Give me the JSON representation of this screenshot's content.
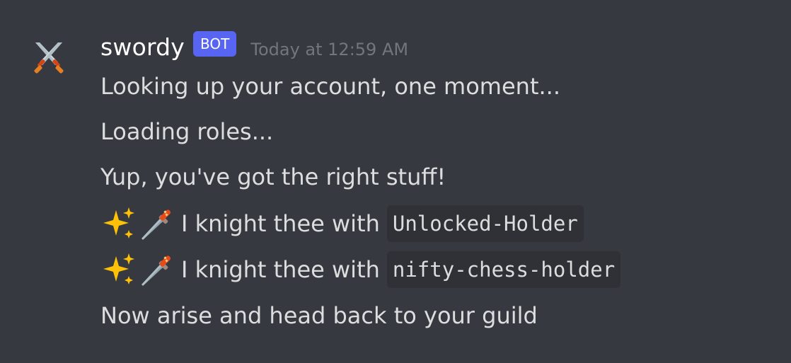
{
  "message": {
    "author": {
      "username": "swordy",
      "bot_tag": "BOT",
      "timestamp": "Today at 12:59 AM",
      "avatar_icon": "crossed-swords-icon"
    },
    "lines": {
      "line1": "Looking up your account, one moment...",
      "line2": "Loading roles...",
      "line3": "Yup, you've got the right stuff!",
      "line4_text": "I knight thee with",
      "line4_role": "Unlocked-Holder",
      "line5_text": "I knight thee with",
      "line5_role": "nifty-chess-holder",
      "line6": "Now arise and head back to your guild"
    },
    "emoji_icons": [
      "sparkles-icon",
      "dagger-icon"
    ],
    "colors": {
      "background": "#36393f",
      "bot_tag": "#5865f2",
      "timestamp": "#72767d",
      "text": "#dcddde",
      "code_bg": "#2f3136"
    }
  }
}
